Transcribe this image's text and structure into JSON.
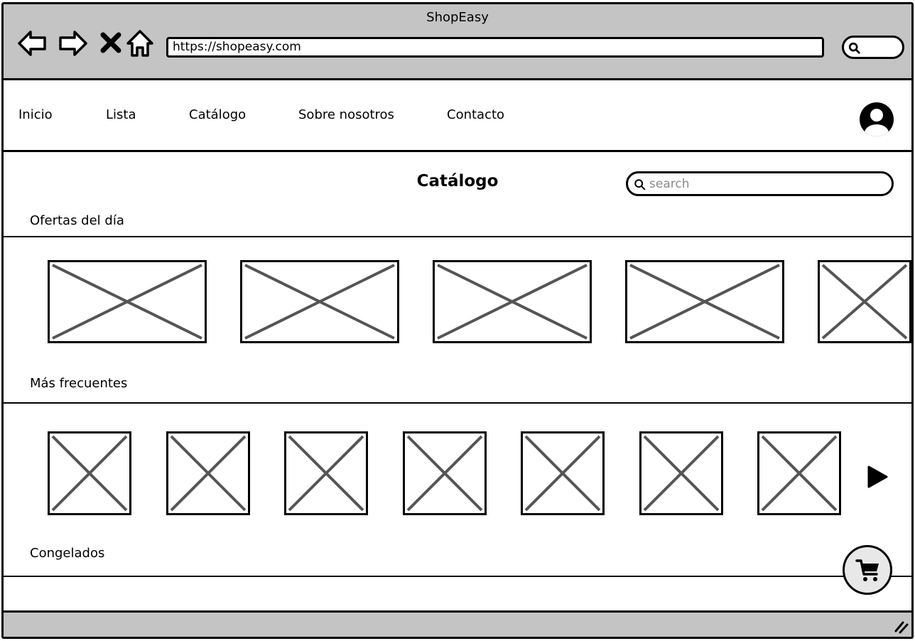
{
  "window": {
    "title": "ShopEasy"
  },
  "browser": {
    "url": "https://shopeasy.com",
    "buttons": [
      "back-icon",
      "forward-icon",
      "close-icon",
      "home-icon"
    ]
  },
  "nav": {
    "links": [
      "Inicio",
      "Lista",
      "Catálogo",
      "Sobre nosotros",
      "Contacto"
    ],
    "avatar_icon": "user-avatar-icon"
  },
  "catalog": {
    "title": "Catálogo",
    "search_placeholder": "search",
    "sections": [
      {
        "label": "Ofertas del día",
        "item_count": 5
      },
      {
        "label": "Más frecuentes",
        "item_count": 7
      },
      {
        "label": "Congelados",
        "item_count": 0
      }
    ],
    "next_icon": "play-arrow-icon",
    "cart_icon": "shopping-cart-icon"
  },
  "colors": {
    "chrome": "#c4c4c4",
    "placeholder_x": "#555555",
    "cart_bg": "#e8e8e8"
  }
}
